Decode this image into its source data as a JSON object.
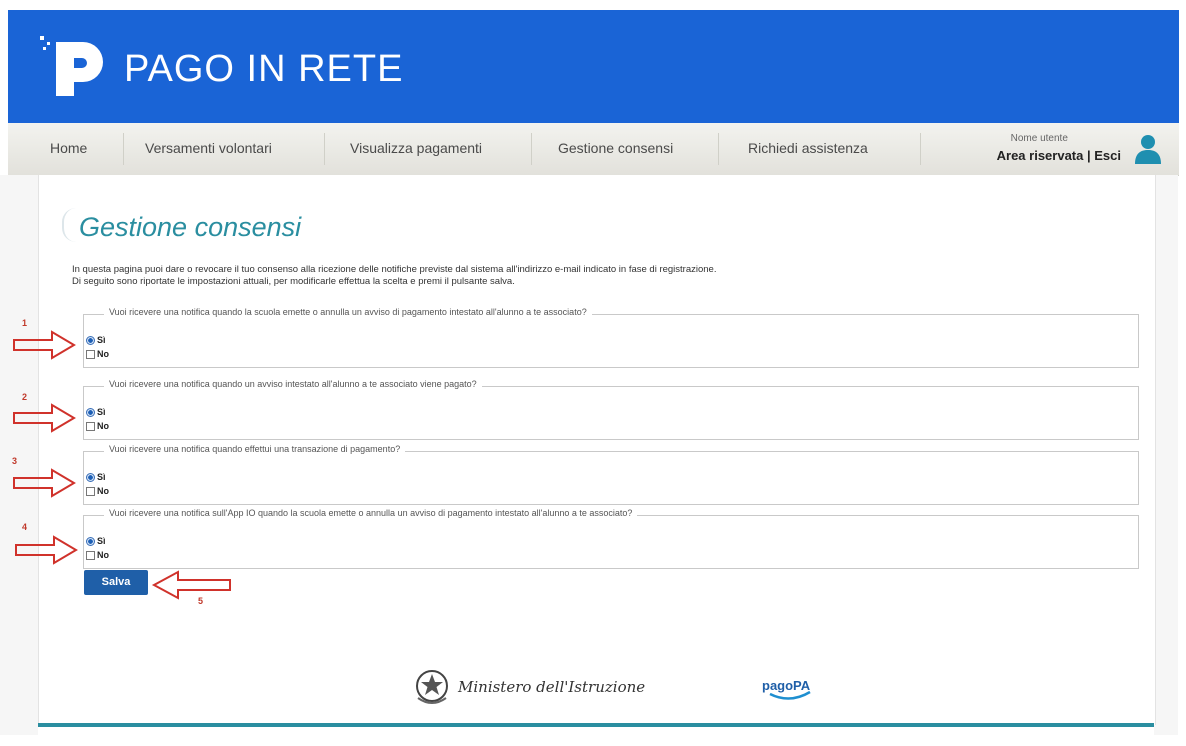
{
  "header": {
    "app_name": "PAGO IN RETE",
    "brand_color": "#1a64d6",
    "logo_icon": "pago-in-rete-logo"
  },
  "nav": {
    "items": [
      {
        "label": "Home"
      },
      {
        "label": "Versamenti volontari"
      },
      {
        "label": "Visualizza pagamenti"
      },
      {
        "label": "Gestione consensi"
      },
      {
        "label": "Richiedi assistenza"
      }
    ],
    "user_label": "Nome utente",
    "area_riservata": "Area riservata",
    "separator": "|",
    "esci": "Esci",
    "user_icon": "user-icon"
  },
  "main": {
    "title": "Gestione consensi",
    "intro_line1": "In questa pagina puoi dare o revocare il tuo consenso alla ricezione delle notifiche previste dal sistema all'indirizzo e-mail indicato in fase di registrazione.",
    "intro_line2": "Di seguito sono riportate le impostazioni attuali, per modificarle effettua la scelta e premi il pulsante salva.",
    "questions": [
      {
        "number": "1",
        "legend": "Vuoi ricevere una notifica quando la scuola emette o annulla un avviso di pagamento intestato all'alunno a te associato?",
        "yes_label": "Sì",
        "no_label": "No",
        "selected": "Sì"
      },
      {
        "number": "2",
        "legend": "Vuoi ricevere una notifica quando un avviso intestato all'alunno a te associato viene pagato?",
        "yes_label": "Sì",
        "no_label": "No",
        "selected": "Sì"
      },
      {
        "number": "3",
        "legend": "Vuoi ricevere una notifica quando effettui una transazione di pagamento?",
        "yes_label": "Sì",
        "no_label": "No",
        "selected": "Sì"
      },
      {
        "number": "4",
        "legend": "Vuoi ricevere una notifica sull'App IO quando la scuola emette o annulla un avviso di pagamento intestato all'alunno a te associato?",
        "yes_label": "Sì",
        "no_label": "No",
        "selected": "Sì"
      }
    ],
    "save_label": "Salva",
    "save_number": "5"
  },
  "footer": {
    "ministry": "Ministero dell'Istruzione",
    "pagopa": "pagoPA",
    "accent": "#2a8ea0"
  }
}
